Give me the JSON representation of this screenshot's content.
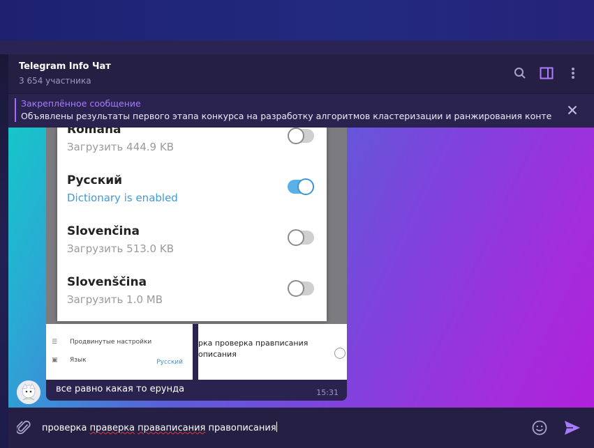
{
  "header": {
    "title": "Telegram Info Чат",
    "subtitle": "3 654 участника",
    "search_icon": "search-icon",
    "sidebar_icon": "sidebar-toggle-icon",
    "more_icon": "more-vertical-icon"
  },
  "pinned": {
    "title": "Закреплённое сообщение",
    "text": "Объявлены результаты первого этапа конкурса на разработку алгоритмов кластеризации и ранжирования контента ..."
  },
  "message": {
    "screenshot": {
      "languages": [
        {
          "name": "Romana",
          "sub": "Загрузить 444.9 KB",
          "enabled": false
        },
        {
          "name": "Русский",
          "sub": "Dictionary is enabled",
          "enabled": true
        },
        {
          "name": "Slovenčina",
          "sub": "Загрузить 513.0 KB",
          "enabled": false
        },
        {
          "name": "Slovenščina",
          "sub": "Загрузить 1.0 MB",
          "enabled": false
        }
      ],
      "settings_rows": [
        {
          "icon": "sliders-icon",
          "label": "Продвинутые настройки"
        },
        {
          "icon": "language-icon",
          "label": "Язык"
        }
      ],
      "language_value": "Русский",
      "spell_line1_prefix": "",
      "spell_line1": "рка проверка правписания",
      "spell_line2": "описания"
    },
    "text": "все равно какая то ерунда",
    "time": "15:31"
  },
  "composer": {
    "input_value": "проверка праверка праваписания правописания",
    "words": [
      "проверка",
      "праверка",
      "праваписания",
      "правописания"
    ],
    "misspelled": [
      false,
      true,
      true,
      false
    ]
  },
  "colors": {
    "accent": "#a77bff",
    "pinned_bar": "#a36bff",
    "panel": "#251f44",
    "toggle_on": "#5ab0e8"
  }
}
